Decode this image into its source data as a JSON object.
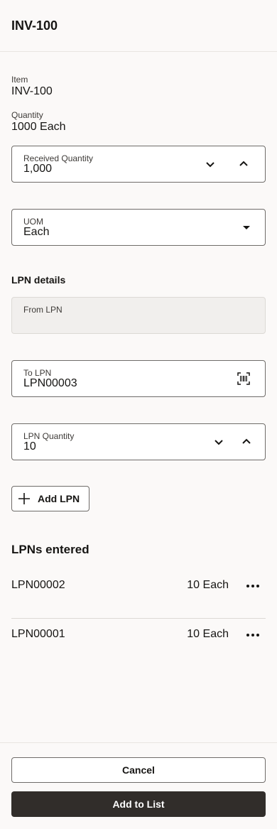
{
  "header": {
    "title": "INV-100"
  },
  "item": {
    "label": "Item",
    "value": "INV-100"
  },
  "quantity": {
    "label": "Quantity",
    "value": "1000 Each"
  },
  "received_quantity": {
    "label": "Received Quantity",
    "value": "1,000"
  },
  "uom": {
    "label": "UOM",
    "value": "Each"
  },
  "lpn_details": {
    "title": "LPN details"
  },
  "from_lpn": {
    "label": "From LPN",
    "value": ""
  },
  "to_lpn": {
    "label": "To LPN",
    "value": "LPN00003"
  },
  "lpn_quantity": {
    "label": "LPN Quantity",
    "value": "10"
  },
  "add_lpn": {
    "label": "Add LPN"
  },
  "lpns_entered": {
    "title": "LPNs entered",
    "rows": [
      {
        "name": "LPN00002",
        "qty": "10 Each"
      },
      {
        "name": "LPN00001",
        "qty": "10 Each"
      }
    ]
  },
  "footer": {
    "cancel_label": "Cancel",
    "add_label": "Add to List"
  },
  "icons": {
    "decrement": "chevron-down-icon",
    "increment": "chevron-up-icon",
    "dropdown": "caret-down-icon",
    "scan": "barcode-scan-icon",
    "add": "plus-icon",
    "more": "more-horizontal-icon"
  },
  "colors": {
    "primary_button": "#312d2a",
    "background": "#fbf9f8",
    "border": "#6f6c69"
  }
}
